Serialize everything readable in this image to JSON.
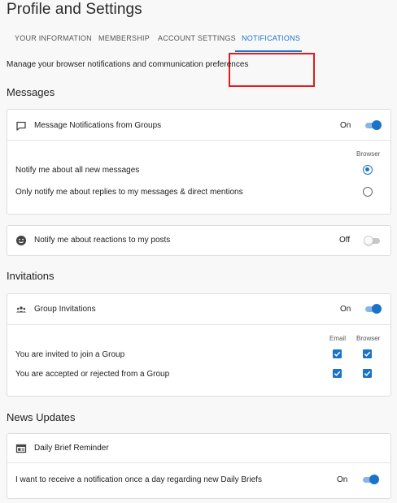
{
  "page": {
    "title": "Profile and Settings",
    "description": "Manage your browser notifications and communication preferences"
  },
  "tabs": [
    {
      "label": "YOUR INFORMATION",
      "active": false
    },
    {
      "label": "MEMBERSHIP",
      "active": false
    },
    {
      "label": "ACCOUNT SETTINGS",
      "active": false
    },
    {
      "label": "NOTIFICATIONS",
      "active": true
    }
  ],
  "colors": {
    "accent": "#1a73c9",
    "highlight": "#e01b1b"
  },
  "messages": {
    "title": "Messages",
    "group_card": {
      "title": "Message Notifications from Groups",
      "icon": "chat-bubble-icon",
      "state": "On",
      "column_header": "Browser",
      "options": [
        {
          "label": "Notify me about all new messages",
          "selected": true
        },
        {
          "label": "Only notify me about replies to my messages & direct mentions",
          "selected": false
        }
      ]
    },
    "reactions_card": {
      "title": "Notify me about reactions to my posts",
      "icon": "smiley-face-icon",
      "state": "Off"
    }
  },
  "invitations": {
    "title": "Invitations",
    "card": {
      "title": "Group Invitations",
      "icon": "group-people-icon",
      "state": "On",
      "columns": [
        "Email",
        "Browser"
      ],
      "rows": [
        {
          "label": "You are invited to join a Group",
          "email": true,
          "browser": true
        },
        {
          "label": "You are accepted or rejected from a Group",
          "email": true,
          "browser": true
        }
      ]
    }
  },
  "news": {
    "title": "News Updates",
    "card": {
      "title": "Daily Brief Reminder",
      "icon": "newspaper-icon",
      "option_label": "I want to receive a notification once a day regarding new Daily Briefs",
      "state": "On"
    }
  }
}
